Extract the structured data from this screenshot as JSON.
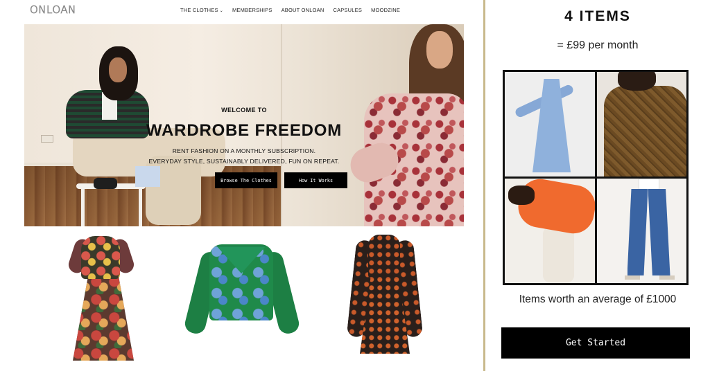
{
  "site": {
    "logo": "ONLOAN",
    "nav": [
      {
        "label": "THE CLOTHES",
        "has_dropdown": true
      },
      {
        "label": "MEMBERSHIPS"
      },
      {
        "label": "ABOUT ONLOAN"
      },
      {
        "label": "CAPSULES"
      },
      {
        "label": "MOODZINE"
      }
    ],
    "hero": {
      "eyebrow": "WELCOME TO",
      "headline": "WARDROBE FREEDOM",
      "tagline_line1": "RENT FASHION ON A MONTHLY SUBSCRIPTION.",
      "tagline_line2": "EVERYDAY STYLE, SUSTAINABLY DELIVERED, FUN ON REPEAT.",
      "buttons": {
        "browse": "Browse The Clothes",
        "how": "How It Works"
      }
    },
    "products": [
      {
        "icon": "floral-midi-dress-icon"
      },
      {
        "icon": "green-printed-blouse-icon"
      },
      {
        "icon": "floral-mini-dress-icon"
      }
    ]
  },
  "panel": {
    "title": "4 ITEMS",
    "price": "= £99 per month",
    "grid_images": [
      "blue-shirt-dress",
      "check-blouse",
      "orange-sheer-top",
      "wide-leg-jeans"
    ],
    "worth": "Items worth an average of £1000",
    "cta": "Get Started"
  },
  "colors": {
    "button_bg": "#000000",
    "button_text": "#ffffff",
    "divider": "#c8b98c"
  }
}
